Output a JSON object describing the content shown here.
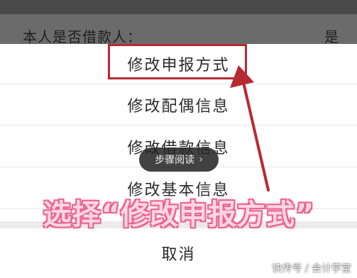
{
  "background_row": {
    "question": "本人是否借款人：",
    "answer": "是"
  },
  "action_sheet": {
    "items": [
      {
        "label": "修改申报方式"
      },
      {
        "label": "修改配偶信息"
      },
      {
        "label": "修改借款信息"
      },
      {
        "label": "修改基本信息"
      }
    ],
    "cancel_label": "取消"
  },
  "toast": {
    "label": "步骤阅读",
    "chevron_icon": "chevron-right-icon"
  },
  "annotation": {
    "caption": "选择“修改申报方式”",
    "highlight_color": "#b72a33",
    "caption_color": "#ffd6e3"
  },
  "watermark": "快传号 / 会计学堂"
}
